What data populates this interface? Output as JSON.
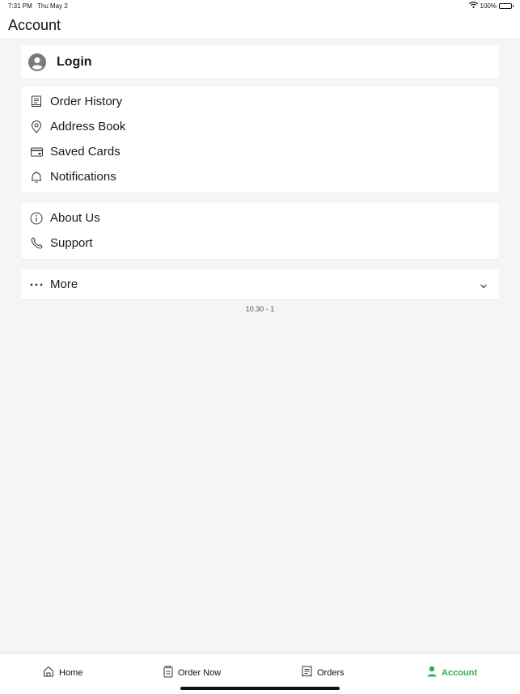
{
  "status_bar": {
    "time": "7:31 PM",
    "date": "Thu May 2",
    "battery_text": "100%",
    "icons": [
      "wifi-icon",
      "battery-icon"
    ]
  },
  "header": {
    "title": "Account"
  },
  "login": {
    "label": "Login",
    "icon": "user-avatar-icon"
  },
  "menu_group_1": [
    {
      "label": "Order History",
      "icon": "receipt-icon"
    },
    {
      "label": "Address Book",
      "icon": "location-pin-icon"
    },
    {
      "label": "Saved Cards",
      "icon": "credit-card-icon"
    },
    {
      "label": "Notifications",
      "icon": "bell-icon"
    }
  ],
  "menu_group_2": [
    {
      "label": "About Us",
      "icon": "info-icon"
    },
    {
      "label": "Support",
      "icon": "phone-icon"
    }
  ],
  "more": {
    "label": "More",
    "icon": "more-dots-icon",
    "toggle_icon": "chevron-down-icon"
  },
  "version": "10.30 - 1",
  "tabbar": {
    "items": [
      {
        "label": "Home",
        "icon": "home-icon",
        "active": false
      },
      {
        "label": "Order Now",
        "icon": "order-now-icon",
        "active": false
      },
      {
        "label": "Orders",
        "icon": "orders-icon",
        "active": false
      },
      {
        "label": "Account",
        "icon": "account-icon",
        "active": true
      }
    ]
  },
  "colors": {
    "accent": "#2bb24c",
    "background": "#f5f5f5",
    "card": "#ffffff",
    "text": "#111111"
  }
}
